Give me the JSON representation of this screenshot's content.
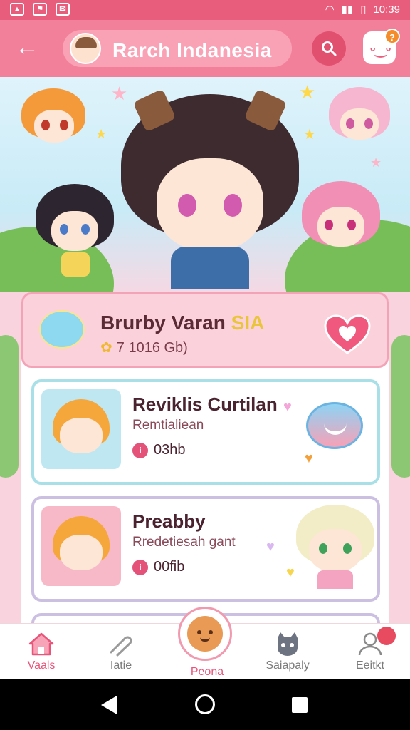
{
  "status_bar": {
    "time": "10:39",
    "icons": [
      "photo-icon",
      "flag-icon",
      "mail-icon",
      "wifi-icon",
      "signal-icon",
      "battery-icon"
    ]
  },
  "app_bar": {
    "title": "Rarch Indanesia",
    "back_icon": "back-arrow-icon",
    "search_icon": "search-icon",
    "message_icon": "chat-face-icon",
    "message_badge": "?"
  },
  "feature": {
    "title_main": "Brurby Varan ",
    "title_highlight": "SIA",
    "subtitle": "7 1016 Gb)",
    "action_icon": "heart-icon"
  },
  "cards": [
    {
      "title": "Reviklis Curtilan",
      "subtitle": "Remtialiean",
      "meta": "03hb",
      "meta_icon": "info-dot-icon"
    },
    {
      "title": "Preabby",
      "subtitle": "Rredetiesah gant",
      "meta": "00fib",
      "meta_icon": "info-dot-icon"
    }
  ],
  "bottom_nav": [
    {
      "label": "Vaals",
      "icon": "home-icon"
    },
    {
      "label": "Iatie",
      "icon": "paperclip-icon"
    },
    {
      "label": "Peona",
      "icon": "bear-face-icon"
    },
    {
      "label": "Saiapaly",
      "icon": "cat-face-icon"
    },
    {
      "label": "Eeitkt",
      "icon": "profile-icon"
    }
  ],
  "bottom_nav_badge": "",
  "colors": {
    "primary": "#f3809b",
    "accent": "#e95d7c",
    "card_blue": "#a9dfe7",
    "card_purple": "#cbbfe2"
  }
}
